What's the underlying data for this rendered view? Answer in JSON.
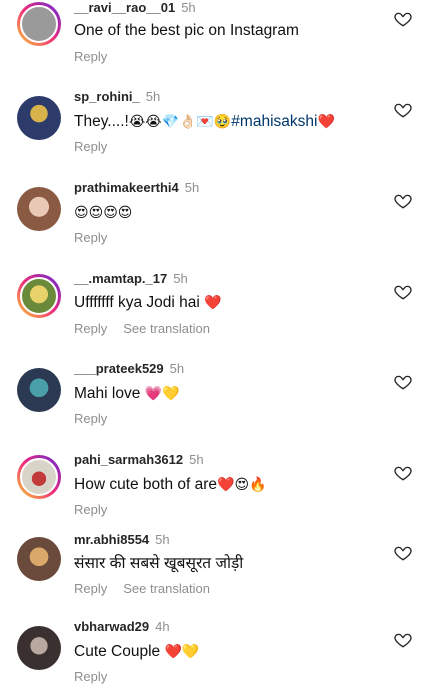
{
  "comments": [
    {
      "username": "__ravi__rao__01",
      "time": "5h",
      "text": "One of the best pic on Instagram",
      "tag": "",
      "emoji": "",
      "reply": "Reply",
      "translate": "",
      "avatar_color": "#9a9a9a",
      "ring": true
    },
    {
      "username": "sp_rohini_",
      "time": "5h",
      "text": "They....!",
      "tag": "#mahisakshi",
      "emoji": "😭😭💎👌🏻💌🥹",
      "emoji_after": "❤️",
      "reply": "Reply",
      "translate": "",
      "avatar_color": "#2c3b6a",
      "ring": false
    },
    {
      "username": "prathimakeerthi4",
      "time": "5h",
      "text": "",
      "tag": "",
      "emoji": "😍😍😍😍",
      "reply": "Reply",
      "translate": "",
      "avatar_color": "#c8a08a",
      "ring": false
    },
    {
      "username": "__.mamtap._17",
      "time": "5h",
      "text": "Ufffffff kya Jodi hai",
      "tag": "",
      "emoji": "❤️",
      "reply": "Reply",
      "translate": "See translation",
      "avatar_color": "#d8c24a",
      "ring": true
    },
    {
      "username": "___prateek529",
      "time": "5h",
      "text": "Mahi love",
      "tag": "",
      "emoji": "💗💛",
      "reply": "Reply",
      "translate": "",
      "avatar_color": "#3b4f6a",
      "ring": false
    },
    {
      "username": "pahi_sarmah3612",
      "time": "5h",
      "text": "How cute both of are",
      "tag": "",
      "emoji": "❤️😍🔥",
      "reply": "Reply",
      "translate": "",
      "avatar_color": "#c23a3a",
      "ring": true
    },
    {
      "username": "mr.abhi8554",
      "time": "5h",
      "text": "संसार की सबसे खूबसूरत जोड़ी",
      "tag": "",
      "emoji": "",
      "reply": "Reply",
      "translate": "See translation",
      "avatar_color": "#6a4a3a",
      "ring": false
    },
    {
      "username": "vbharwad29",
      "time": "4h",
      "text": "Cute Couple",
      "tag": "",
      "emoji": "❤️💛",
      "reply": "Reply",
      "translate": "",
      "avatar_color": "#3a3030",
      "ring": false
    }
  ],
  "icons": {
    "heart": "heart-outline-icon"
  },
  "colors": {
    "username": "#262626",
    "meta": "#8e8e8e",
    "hashtag": "#00376b",
    "heart_stroke": "#262626"
  }
}
